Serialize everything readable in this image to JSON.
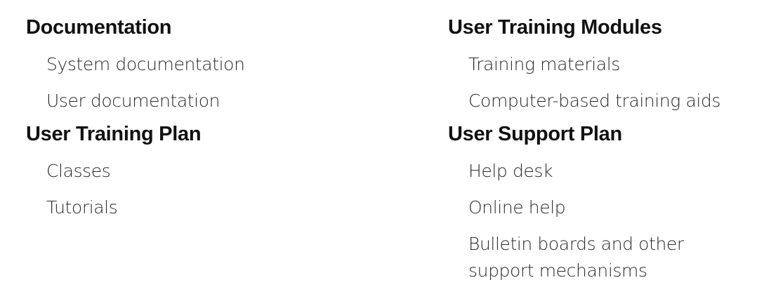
{
  "left_column": {
    "sections": [
      {
        "heading": "Documentation",
        "items": [
          "System documentation",
          "User documentation"
        ]
      },
      {
        "heading": "User Training Plan",
        "items": [
          "Classes",
          "Tutorials"
        ]
      }
    ]
  },
  "right_column": {
    "sections": [
      {
        "heading": "User Training Modules",
        "items": [
          "Training materials",
          "Computer-based training aids"
        ]
      },
      {
        "heading": "User Support Plan",
        "items": [
          "Help desk",
          "Online help",
          "Bulletin boards and other support mechanisms"
        ]
      }
    ]
  }
}
